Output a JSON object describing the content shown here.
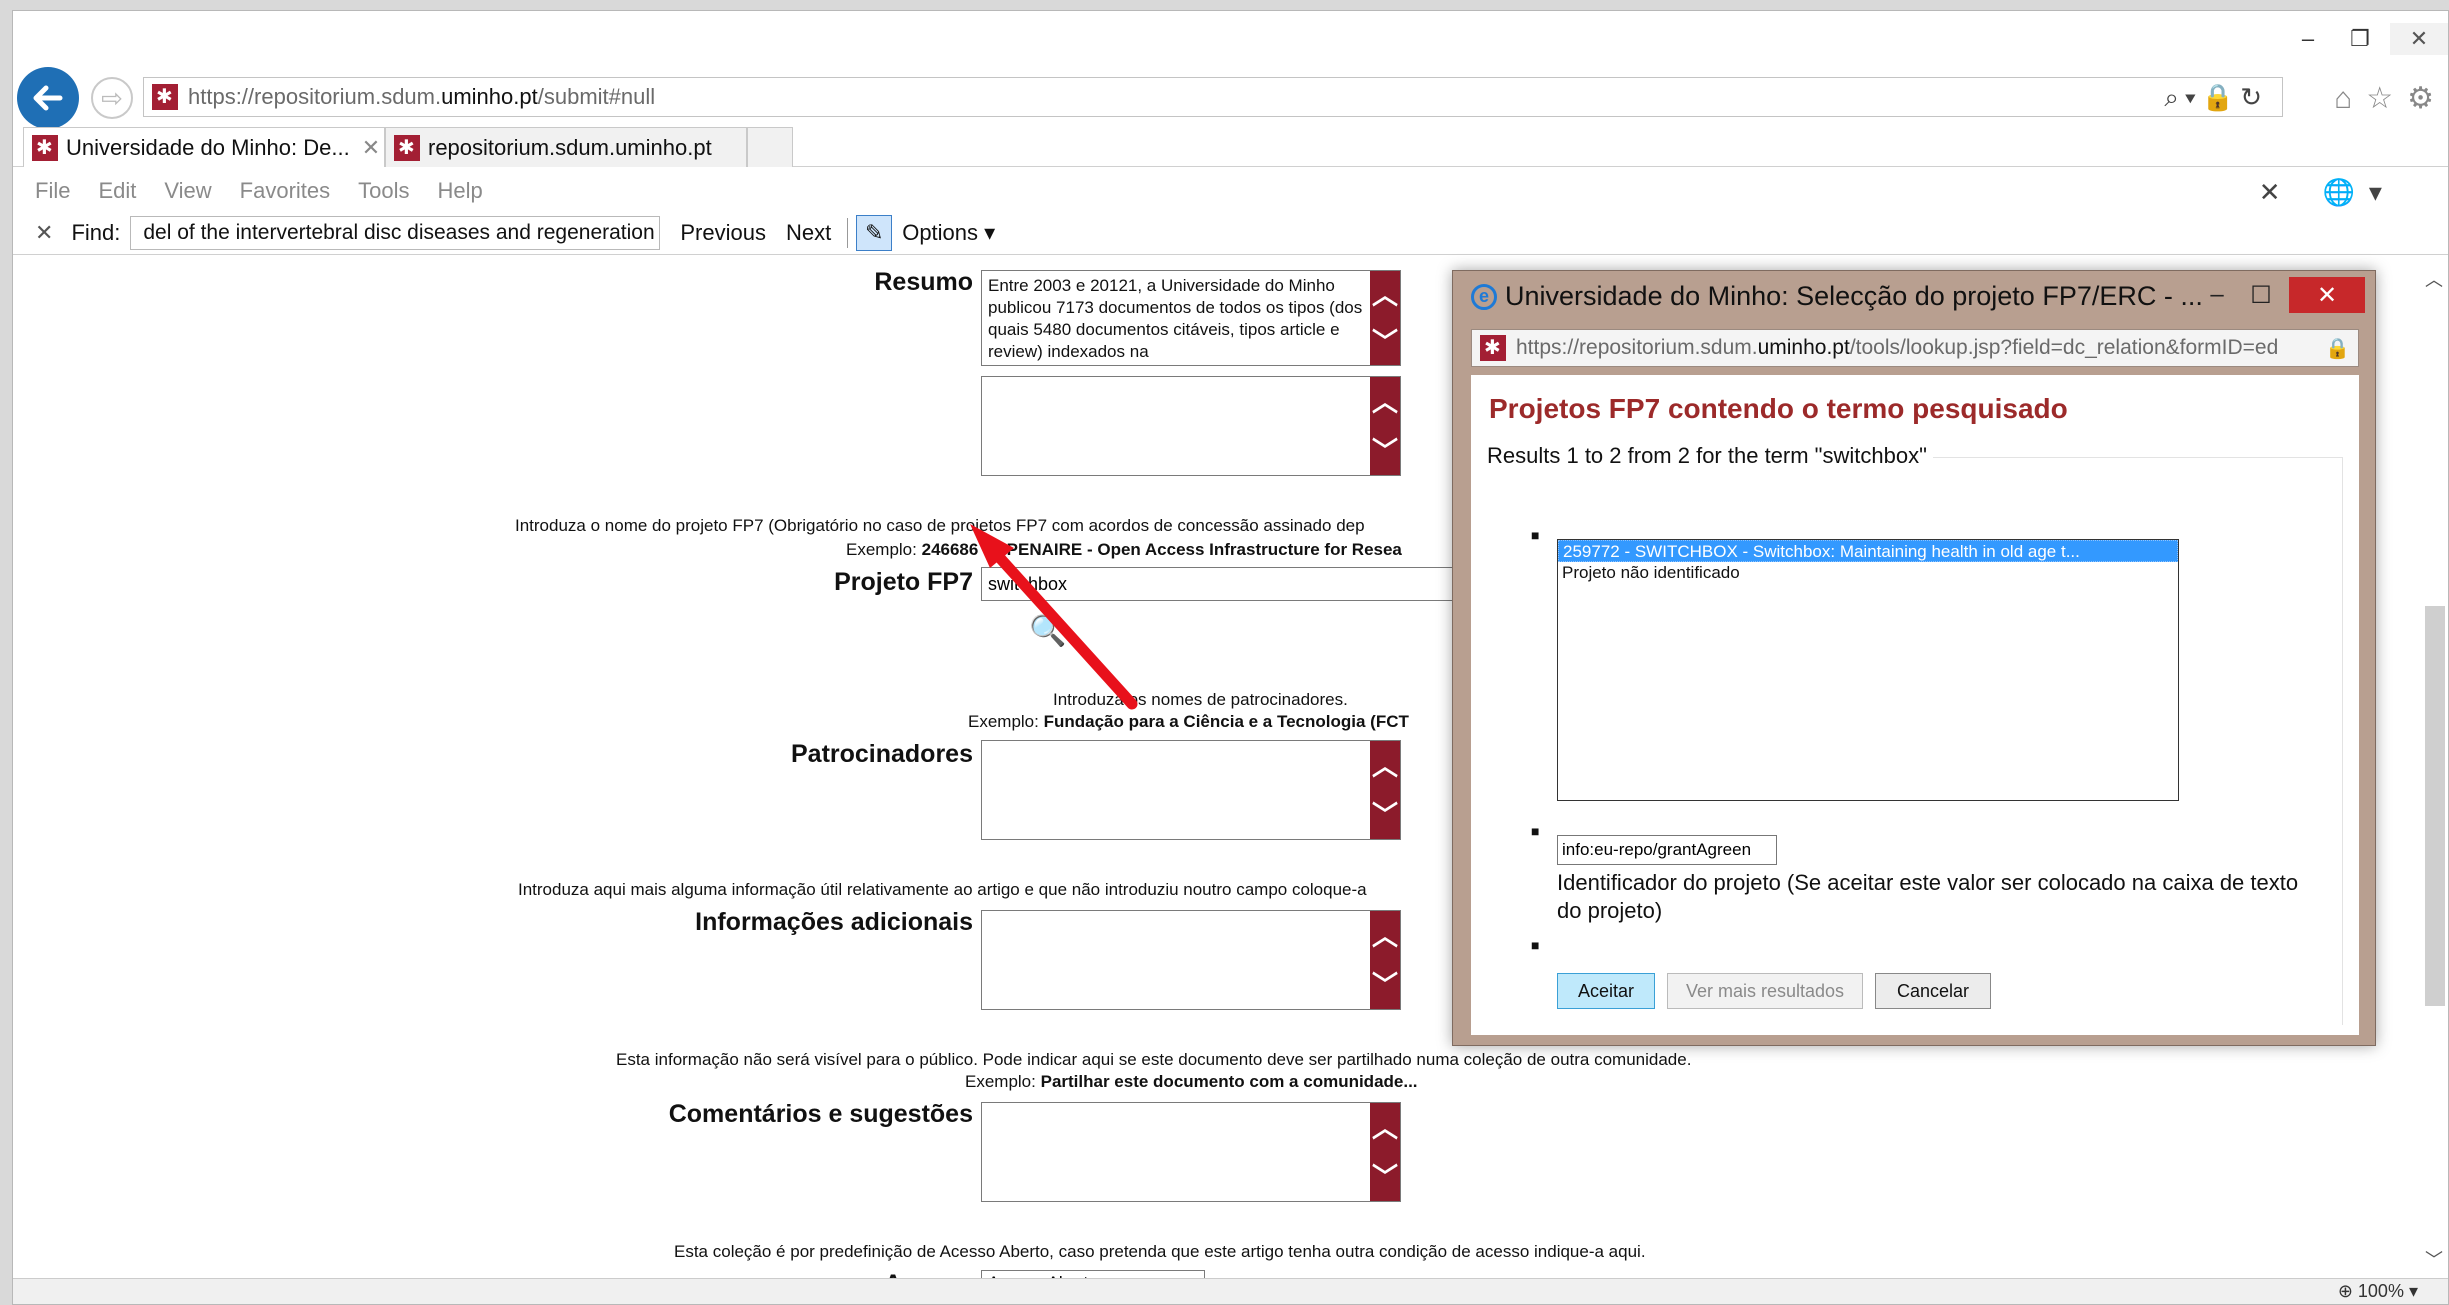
{
  "browser": {
    "url_prefix": "https://repositorium.sdum.",
    "url_domain": "uminho.pt",
    "url_suffix": "/submit#null",
    "tabs": [
      {
        "label": "Universidade do Minho: De..."
      },
      {
        "label": "repositorium.sdum.uminho.pt"
      }
    ],
    "menu": [
      "File",
      "Edit",
      "View",
      "Favorites",
      "Tools",
      "Help"
    ],
    "find": {
      "label": "Find:",
      "value": "del of the intervertebral disc diseases and regeneration",
      "previous": "Previous",
      "next": "Next",
      "options": "Options"
    },
    "zoom": "100%"
  },
  "form": {
    "resumo_label": "Resumo",
    "resumo_text": "Entre 2003 e 20121, a Universidade do Minho publicou 7173 documentos de todos os tipos (dos quais 5480 documentos citáveis, tipos article e review) indexados na",
    "fp7_hint": "Introduza o nome do projeto FP7 (Obrigatório no caso de projetos FP7 com acordos de concessão assinado dep",
    "fp7_example_prefix": "Exemplo:",
    "fp7_example": "246686 - OPENAIRE - Open Access Infrastructure for Resea",
    "fp7_label": "Projeto FP7",
    "fp7_value": "switchbox",
    "sponsors_hint": "Introduza os nomes de patrocinadores.",
    "sponsors_example_prefix": "Exemplo:",
    "sponsors_example": "Fundação para a Ciência e a Tecnologia (FCT",
    "sponsors_label": "Patrocinadores",
    "extra_hint": "Introduza aqui mais alguma informação útil relativamente ao artigo e que não introduziu noutro campo coloque-a",
    "extra_label": "Informações adicionais",
    "comments_hint": "Esta informação não será visível para o público. Pode indicar aqui se este documento deve ser partilhado numa coleção de outra comunidade.",
    "comments_example_prefix": "Exemplo:",
    "comments_example": "Partilhar este documento com a comunidade...",
    "comments_label": "Comentários e sugestões",
    "access_hint": "Esta coleção é por predefinição de Acesso Aberto, caso pretenda que este artigo tenha outra condição de acesso indique-a aqui.",
    "access_label": "Acesso",
    "access_value": "Acesso Aberto"
  },
  "popup": {
    "title": "Universidade do Minho: Selecção do projeto FP7/ERC - ...",
    "url_prefix": "https://repositorium.sdum.",
    "url_domain": "uminho.pt",
    "url_suffix": "/tools/lookup.jsp?field=dc_relation&formID=ed",
    "heading": "Projetos FP7 contendo o termo pesquisado",
    "results_legend": "Results 1 to 2 from 2 for the term \"switchbox\"",
    "options": [
      "259772 - SWITCHBOX - Switchbox: Maintaining health in old age t...",
      "Projeto não identificado"
    ],
    "identifier_value": "info:eu-repo/grantAgreen",
    "identifier_text": "Identificador do projeto (Se aceitar este valor ser colocado na caixa de texto do projeto)",
    "accept": "Aceitar",
    "more": "Ver mais resultados",
    "cancel": "Cancelar"
  },
  "colors": {
    "accent_red": "#8c1b2b",
    "heading_red": "#9c2a2a",
    "popup_frame": "#b89f90",
    "annotation_arrow": "#e8111b"
  }
}
